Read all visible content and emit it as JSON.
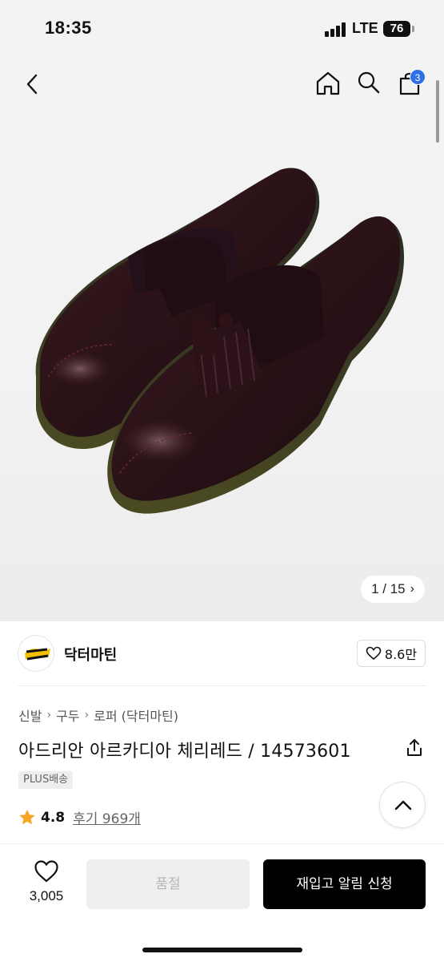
{
  "status_bar": {
    "time": "18:35",
    "network": "LTE",
    "battery": "76"
  },
  "header": {
    "cart_count": "3",
    "icons": [
      "chevron-left-icon",
      "home-icon",
      "search-icon",
      "shopping-bag-icon"
    ]
  },
  "gallery": {
    "counter": "1 / 15",
    "next_glyph": "›"
  },
  "brand": {
    "name": "닥터마틴",
    "likes": "8.6만"
  },
  "breadcrumb": {
    "items": [
      "신발",
      "구두",
      "로퍼 (닥터마틴)"
    ],
    "separator": "›"
  },
  "product": {
    "title": "아드리안 아르카디아 체리레드 / 14573601",
    "shipping_badge": "PLUS배송",
    "rating": "4.8",
    "reviews": "후기 969개"
  },
  "action_bar": {
    "wish_count": "3,005",
    "soldout_label": "품절",
    "restock_label": "재입고 알림 신청"
  },
  "colors": {
    "accent_badge": "#2f6fe8",
    "star": "#f5a623",
    "primary_button": "#000000",
    "disabled_button": "#efefef"
  }
}
